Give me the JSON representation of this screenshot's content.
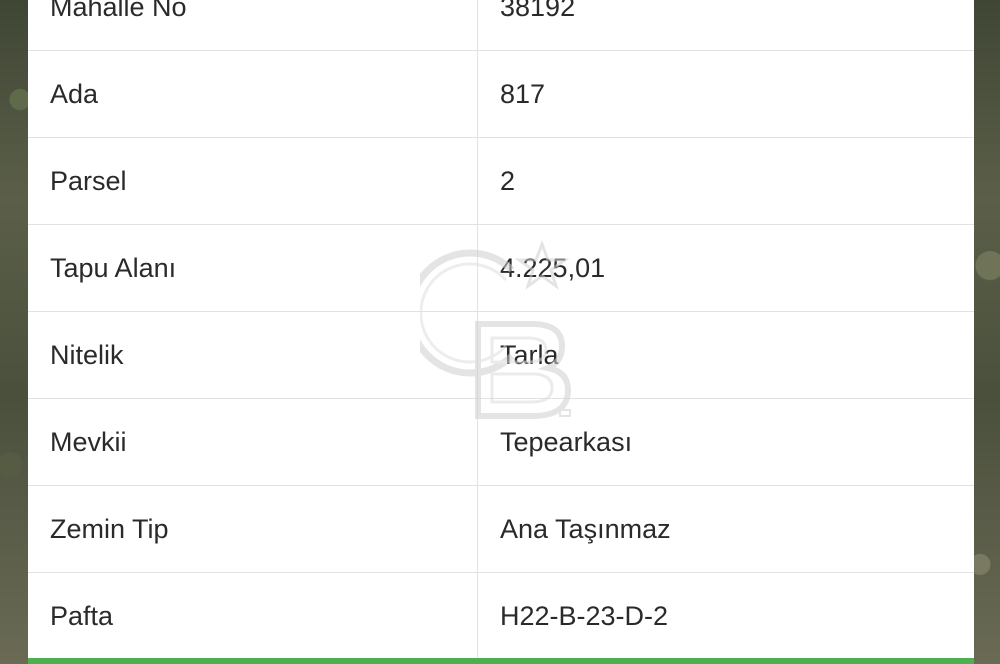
{
  "table": {
    "rows": [
      {
        "label": "Mahalle No",
        "value": "38192"
      },
      {
        "label": "Ada",
        "value": "817"
      },
      {
        "label": "Parsel",
        "value": "2"
      },
      {
        "label": "Tapu Alanı",
        "value": "4.225,01"
      },
      {
        "label": "Nitelik",
        "value": "Tarla"
      },
      {
        "label": "Mevkii",
        "value": "Tepearkası"
      },
      {
        "label": "Zemin Tip",
        "value": "Ana Taşınmaz"
      },
      {
        "label": "Pafta",
        "value": "H22-B-23-D-2"
      }
    ]
  },
  "watermark": {
    "icon": "cb-logo-icon"
  },
  "colors": {
    "accent_bar": "#4caf50",
    "panel_bg": "#ffffff",
    "row_border": "#e2e2e2",
    "text": "#2a2a2a"
  }
}
